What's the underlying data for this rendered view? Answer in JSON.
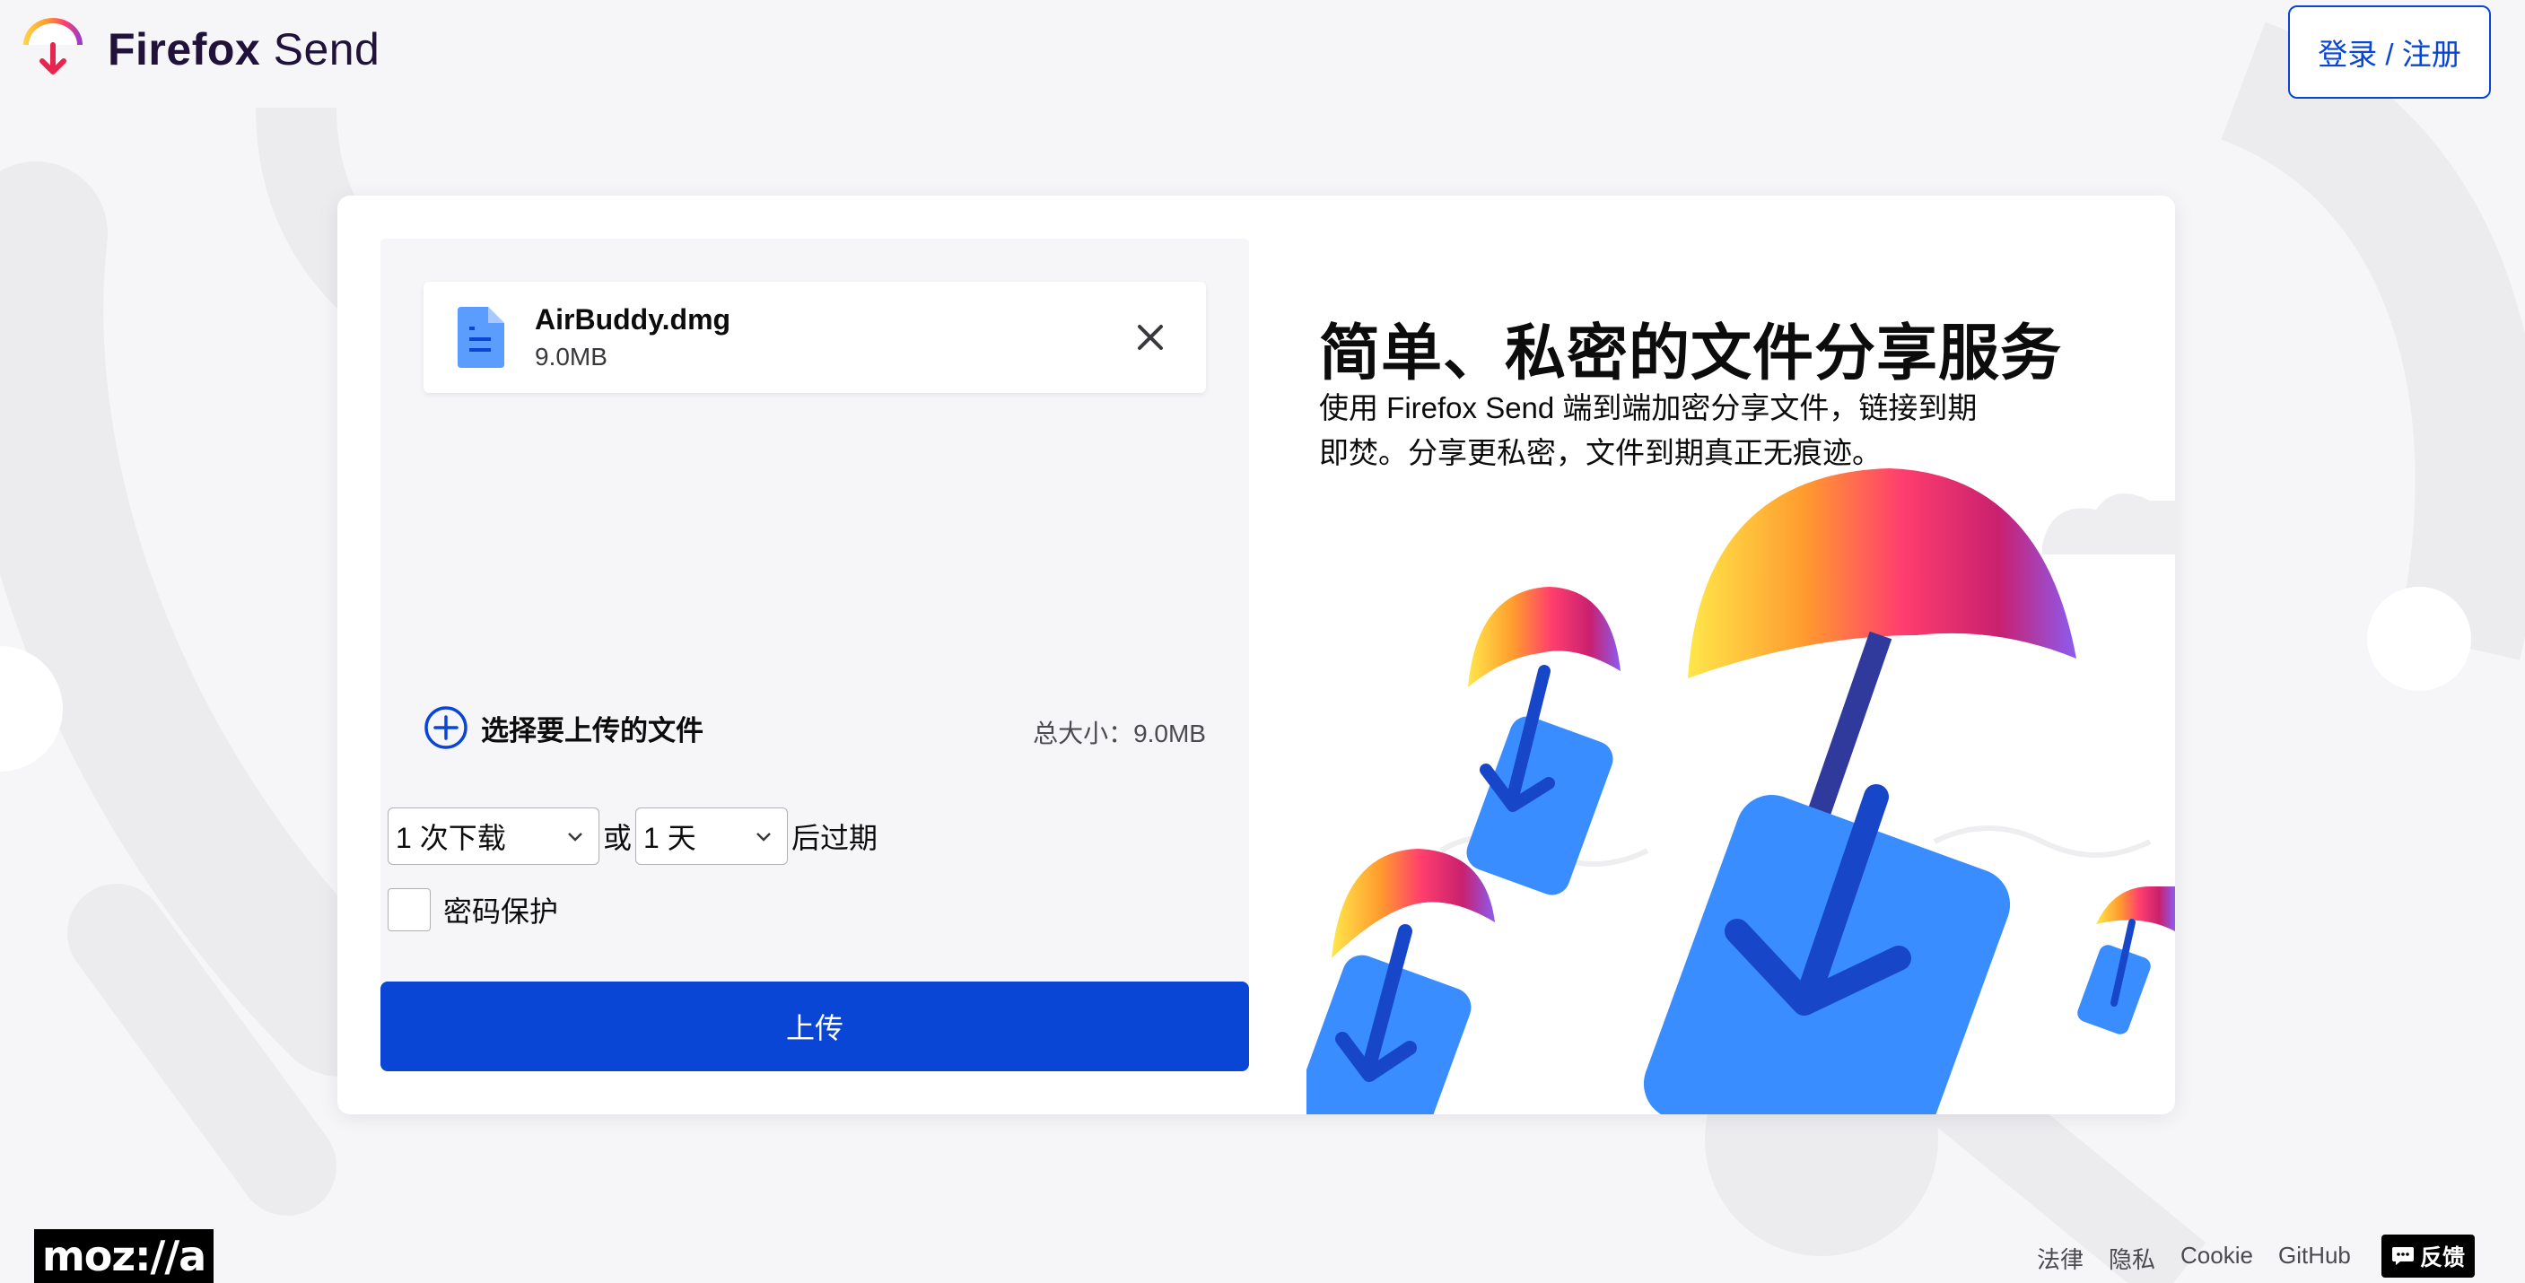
{
  "header": {
    "brand_bold": "Firefox",
    "brand_light": " Send",
    "signin_label": "登录 / 注册"
  },
  "upload": {
    "file": {
      "name": "AirBuddy.dmg",
      "size": "9.0MB",
      "icon": "document-icon"
    },
    "add_files_label": "选择要上传的文件",
    "total_size": "总大小：9.0MB",
    "downloads_select": "1 次下载",
    "or_text": "或",
    "time_select": "1 天",
    "expire_text": "后过期",
    "password_label": "密码保护",
    "password_checked": false,
    "upload_button": "上传"
  },
  "intro": {
    "title": "简单、私密的文件分享服务",
    "description": "使用 Firefox Send 端到端加密分享文件，链接到期即焚。分享更私密，文件到期真正无痕迹。"
  },
  "footer": {
    "mozilla_logo": "moz://a",
    "links": [
      "法律",
      "隐私",
      "Cookie",
      "GitHub"
    ],
    "feedback": "反馈"
  },
  "colors": {
    "accent": "#0a46d6",
    "background": "#f6f6f8",
    "card": "#ffffff"
  }
}
